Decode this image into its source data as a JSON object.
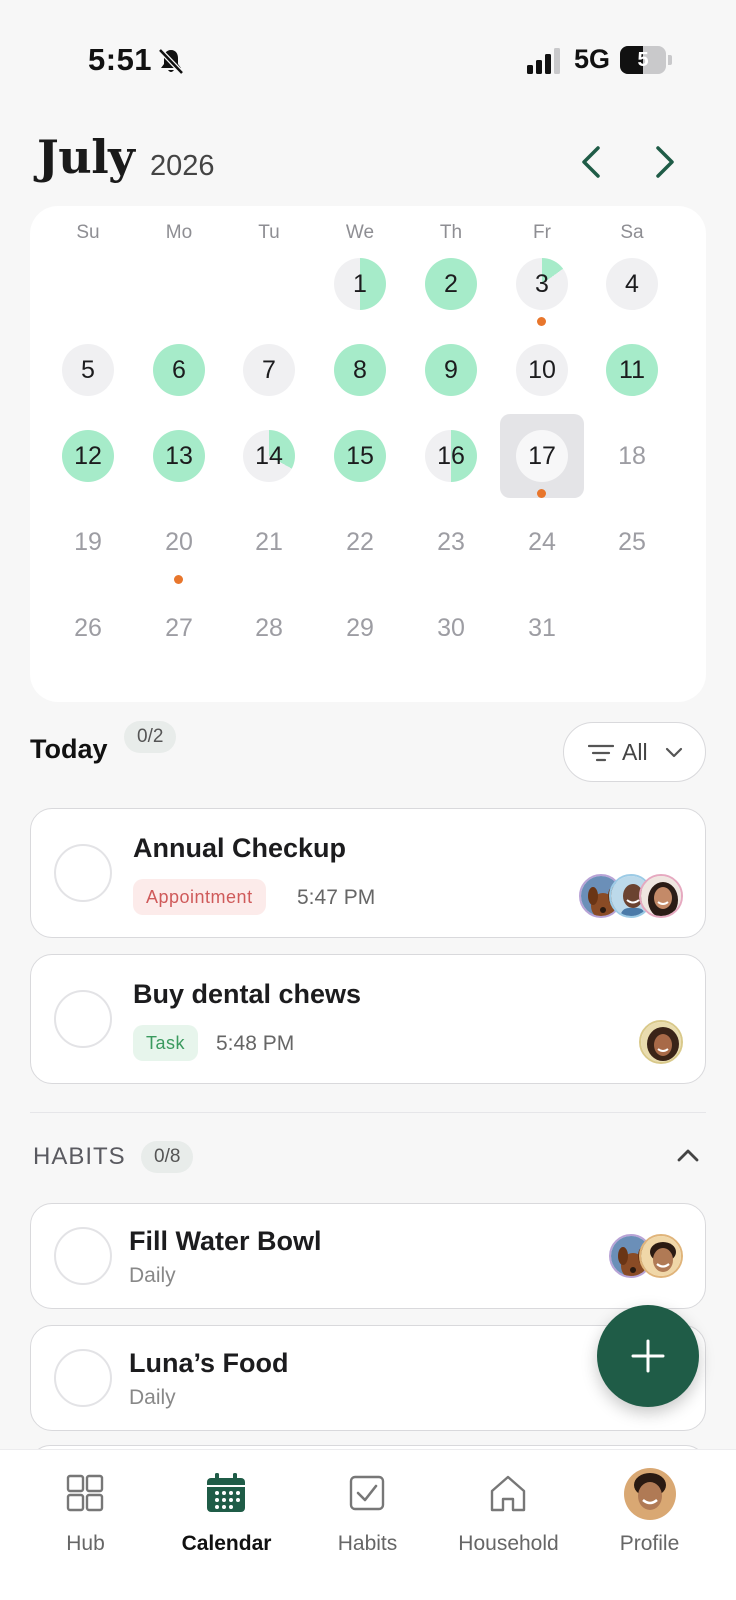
{
  "status_bar": {
    "time": "5:51",
    "network": "5G",
    "battery": "5",
    "battery_level": 0.5
  },
  "header": {
    "month": "July",
    "year": "2026"
  },
  "calendar": {
    "weekdays": [
      "Su",
      "Mo",
      "Tu",
      "We",
      "Th",
      "Fr",
      "Sa"
    ],
    "first_weekday_index": 3,
    "days": [
      {
        "n": "1",
        "progress": 0.5,
        "dot": false,
        "future": false
      },
      {
        "n": "2",
        "progress": 1,
        "dot": false,
        "future": false
      },
      {
        "n": "3",
        "progress": 0.15,
        "dot": true,
        "future": false
      },
      {
        "n": "4",
        "progress": 0,
        "dot": false,
        "future": false
      },
      {
        "n": "5",
        "progress": 0,
        "dot": false,
        "future": false
      },
      {
        "n": "6",
        "progress": 1,
        "dot": false,
        "future": false
      },
      {
        "n": "7",
        "progress": 0,
        "dot": false,
        "future": false
      },
      {
        "n": "8",
        "progress": 1,
        "dot": false,
        "future": false
      },
      {
        "n": "9",
        "progress": 1,
        "dot": false,
        "future": false
      },
      {
        "n": "10",
        "progress": 0,
        "dot": false,
        "future": false
      },
      {
        "n": "11",
        "progress": 1,
        "dot": false,
        "future": false
      },
      {
        "n": "12",
        "progress": 1,
        "dot": false,
        "future": false
      },
      {
        "n": "13",
        "progress": 1,
        "dot": false,
        "future": false
      },
      {
        "n": "14",
        "progress": 0.33,
        "dot": false,
        "future": false
      },
      {
        "n": "15",
        "progress": 1,
        "dot": false,
        "future": false
      },
      {
        "n": "16",
        "progress": 0.5,
        "dot": false,
        "future": false
      },
      {
        "n": "17",
        "progress": 0,
        "dot": true,
        "future": false,
        "selected": true
      },
      {
        "n": "18",
        "progress": 0,
        "dot": false,
        "future": true
      },
      {
        "n": "19",
        "progress": 0,
        "dot": false,
        "future": true
      },
      {
        "n": "20",
        "progress": 0,
        "dot": true,
        "future": true
      },
      {
        "n": "21",
        "progress": 0,
        "dot": false,
        "future": true
      },
      {
        "n": "22",
        "progress": 0,
        "dot": false,
        "future": true
      },
      {
        "n": "23",
        "progress": 0,
        "dot": false,
        "future": true
      },
      {
        "n": "24",
        "progress": 0,
        "dot": false,
        "future": true
      },
      {
        "n": "25",
        "progress": 0,
        "dot": false,
        "future": true
      },
      {
        "n": "26",
        "progress": 0,
        "dot": false,
        "future": true
      },
      {
        "n": "27",
        "progress": 0,
        "dot": false,
        "future": true
      },
      {
        "n": "28",
        "progress": 0,
        "dot": false,
        "future": true
      },
      {
        "n": "29",
        "progress": 0,
        "dot": false,
        "future": true
      },
      {
        "n": "30",
        "progress": 0,
        "dot": false,
        "future": true
      },
      {
        "n": "31",
        "progress": 0,
        "dot": false,
        "future": true
      }
    ]
  },
  "today": {
    "title": "Today",
    "count": "0/2",
    "filter": {
      "label": "All"
    },
    "items": [
      {
        "title": "Annual Checkup",
        "tag": "Appointment",
        "time": "5:47 PM",
        "avatars": [
          "dog-avatar",
          "man-avatar",
          "woman-avatar"
        ]
      },
      {
        "title": "Buy dental chews",
        "tag": "Task",
        "time": "5:48 PM",
        "avatars": [
          "woman-avatar"
        ]
      }
    ]
  },
  "habits": {
    "title": "HABITS",
    "count": "0/8",
    "items": [
      {
        "title": "Fill Water Bowl",
        "frequency": "Daily",
        "avatars": [
          "dog-avatar",
          "man-avatar"
        ]
      },
      {
        "title": "Luna’s Food",
        "frequency": "Daily"
      }
    ]
  },
  "tabs": [
    {
      "label": "Hub",
      "icon": "grid-icon"
    },
    {
      "label": "Calendar",
      "icon": "calendar-icon",
      "active": true
    },
    {
      "label": "Habits",
      "icon": "checkbox-icon"
    },
    {
      "label": "Household",
      "icon": "house-icon"
    },
    {
      "label": "Profile",
      "icon": "profile-avatar"
    }
  ],
  "colors": {
    "accent": "#1f5c47",
    "progress_green": "#a6ebc9",
    "empty_day": "#f0f0f2",
    "dot_orange": "#e8762c",
    "appointment_tag": "#cf5a5a",
    "task_tag": "#3a9a5e"
  }
}
